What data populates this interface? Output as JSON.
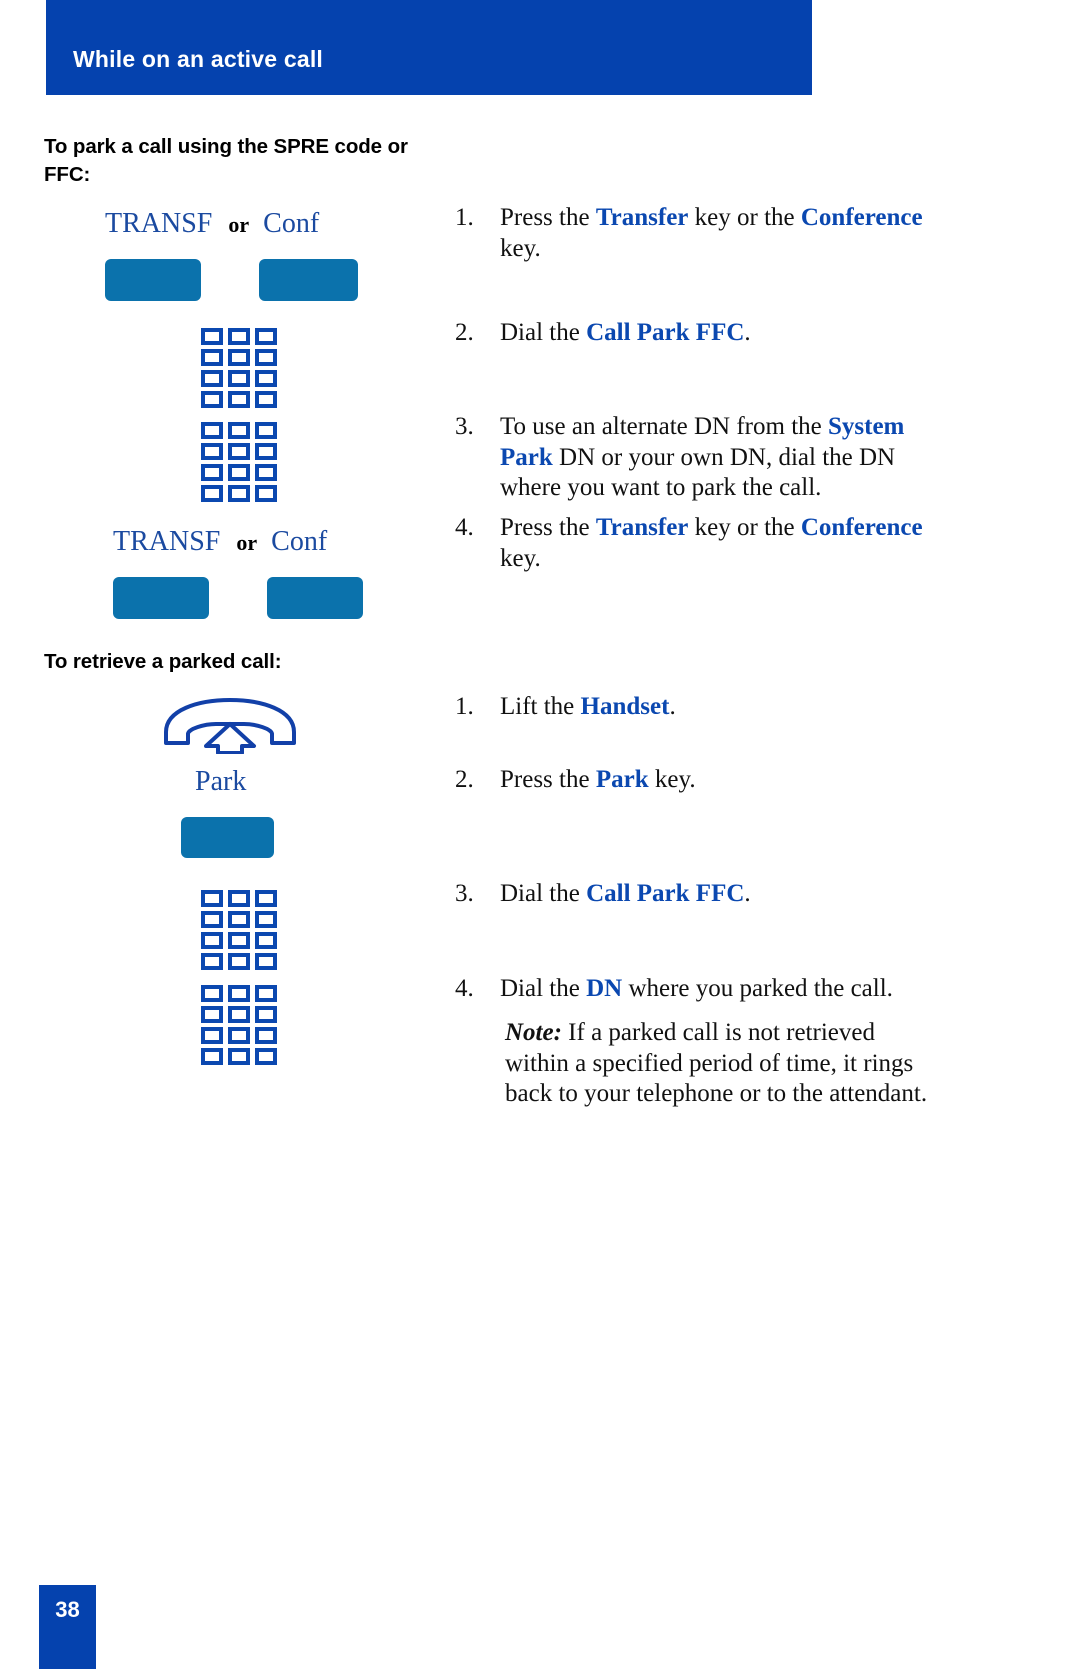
{
  "header": {
    "title": "While on an active call"
  },
  "sections": [
    {
      "id": "park",
      "heading": "To park a call using the SPRE code or FFC:"
    },
    {
      "id": "retrieve",
      "heading": "To retrieve a parked call:"
    }
  ],
  "labels": {
    "transf": "TRANSF",
    "conf": "Conf",
    "or": "or",
    "park": "Park"
  },
  "steps_park": [
    {
      "num": "1.",
      "parts": [
        "Press the ",
        "Transfer",
        " key or the ",
        "Conference",
        " key."
      ]
    },
    {
      "num": "2.",
      "parts": [
        "Dial the ",
        "Call Park FFC",
        "."
      ]
    },
    {
      "num": "3.",
      "parts": [
        "To use an alternate DN from the ",
        "System Park",
        " DN or your own DN, dial the DN where you want to park the call."
      ]
    },
    {
      "num": "4.",
      "parts": [
        "Press the ",
        "Transfer",
        " key or the ",
        "Conference",
        " key."
      ]
    }
  ],
  "steps_retrieve": [
    {
      "num": "1.",
      "parts": [
        "Lift the ",
        "Handset",
        "."
      ]
    },
    {
      "num": "2.",
      "parts": [
        "Press the ",
        "Park",
        " key."
      ]
    },
    {
      "num": "3.",
      "parts": [
        "Dial the ",
        "Call Park FFC",
        "."
      ]
    },
    {
      "num": "4.",
      "parts": [
        "Dial the ",
        "DN",
        " where you parked the call."
      ]
    }
  ],
  "note": {
    "lead": "Note:",
    "body": " If a parked call is not retrieved within a specified period of time, it rings back to your telephone or to the attendant."
  },
  "page": {
    "number": "38"
  },
  "colors": {
    "banner_blue": "#0542ae",
    "key_blue": "#0b72ac",
    "icon_blue": "#0b48b0",
    "label_blue": "#1b4aa0"
  },
  "icons": {
    "keypad": "keypad-icon",
    "handset": "handset-lift-icon"
  }
}
